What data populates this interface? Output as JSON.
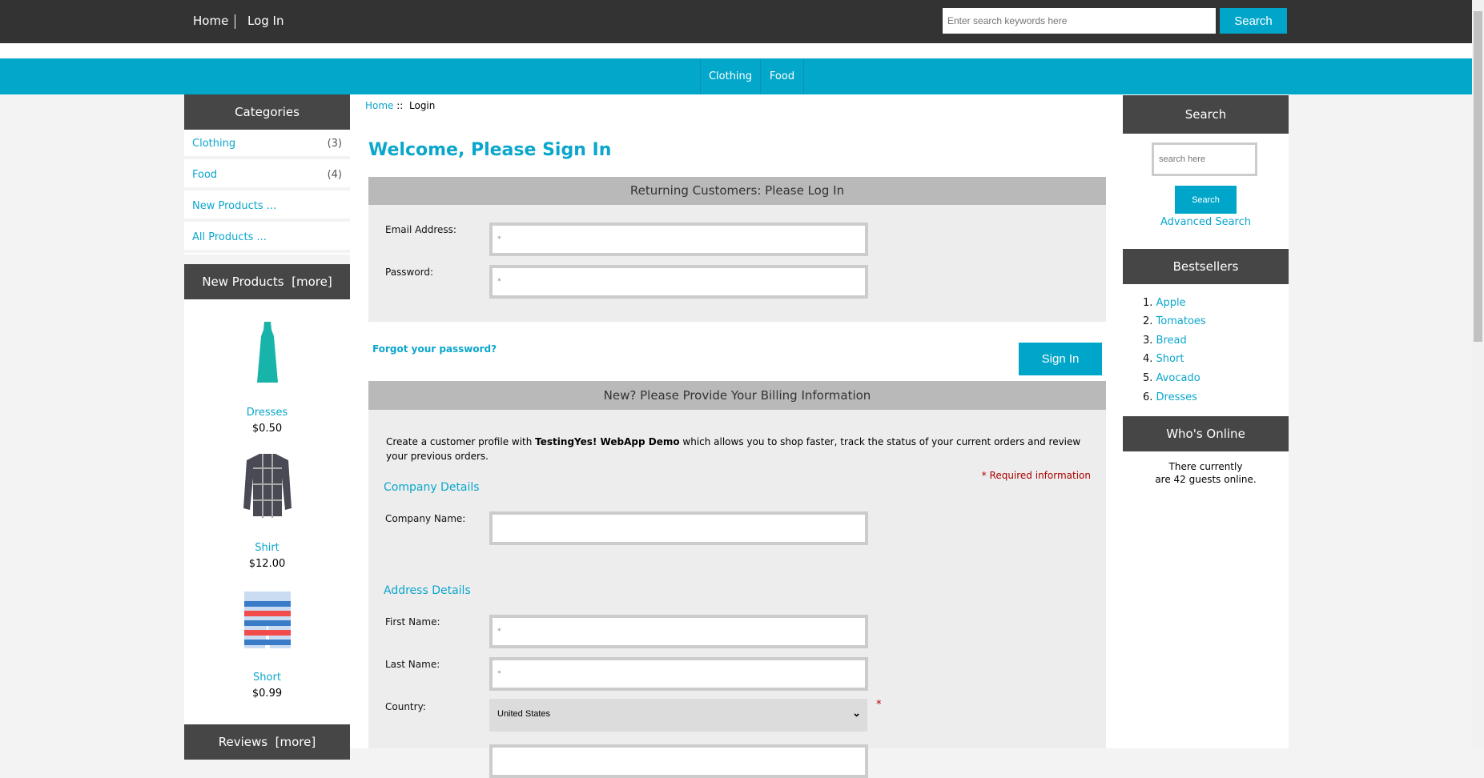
{
  "header": {
    "home": "Home",
    "login": "Log In",
    "search_placeholder": "Enter search keywords here",
    "search_button": "Search"
  },
  "nav": {
    "items": [
      "Clothing",
      "Food"
    ]
  },
  "categories": {
    "title": "Categories",
    "items": [
      {
        "label": "Clothing",
        "count": "(3)"
      },
      {
        "label": "Food",
        "count": "(4)"
      },
      {
        "label": "New Products ..."
      },
      {
        "label": "All Products ..."
      }
    ]
  },
  "new_products": {
    "title": "New Products",
    "more": "[more]",
    "items": [
      {
        "name": "Dresses",
        "price": "$0.50"
      },
      {
        "name": "Shirt",
        "price": "$12.00"
      },
      {
        "name": "Short",
        "price": "$0.99"
      }
    ]
  },
  "reviews": {
    "title": "Reviews",
    "more": "[more]"
  },
  "breadcrumb": {
    "home": "Home",
    "sep": "::",
    "current": "Login"
  },
  "main": {
    "title": "Welcome, Please Sign In",
    "returning": {
      "header": "Returning Customers: Please Log In",
      "email_label": "Email Address:",
      "password_label": "Password:",
      "email_placeholder": "*",
      "password_placeholder": "*",
      "forgot": "Forgot your password?",
      "sign_in": "Sign In"
    },
    "billing": {
      "header": "New? Please Provide Your Billing Information",
      "intro_pre": "Create a customer profile with ",
      "intro_brand": "TestingYes! WebApp Demo",
      "intro_post": " which allows you to shop faster, track the status of your current orders and review your previous orders.",
      "required": "* Required information",
      "company_section": "Company Details",
      "company_label": "Company Name:",
      "address_section": "Address Details",
      "first_label": "First Name:",
      "last_label": "Last Name:",
      "country_label": "Country:",
      "country_value": "United States",
      "required_mark": "*",
      "field_placeholder": "*"
    }
  },
  "right": {
    "search_title": "Search",
    "search_placeholder": "search here",
    "search_button": "Search",
    "advanced": "Advanced Search",
    "bestsellers_title": "Bestsellers",
    "bestsellers": [
      "Apple",
      "Tomatoes",
      "Bread",
      "Short",
      "Avocado",
      "Dresses"
    ],
    "online_title": "Who's Online",
    "online_line1": "There currently",
    "online_line2": "are 42 guests online."
  },
  "colors": {
    "accent": "#00a6ca",
    "dark": "#333333",
    "panel": "#464646"
  }
}
